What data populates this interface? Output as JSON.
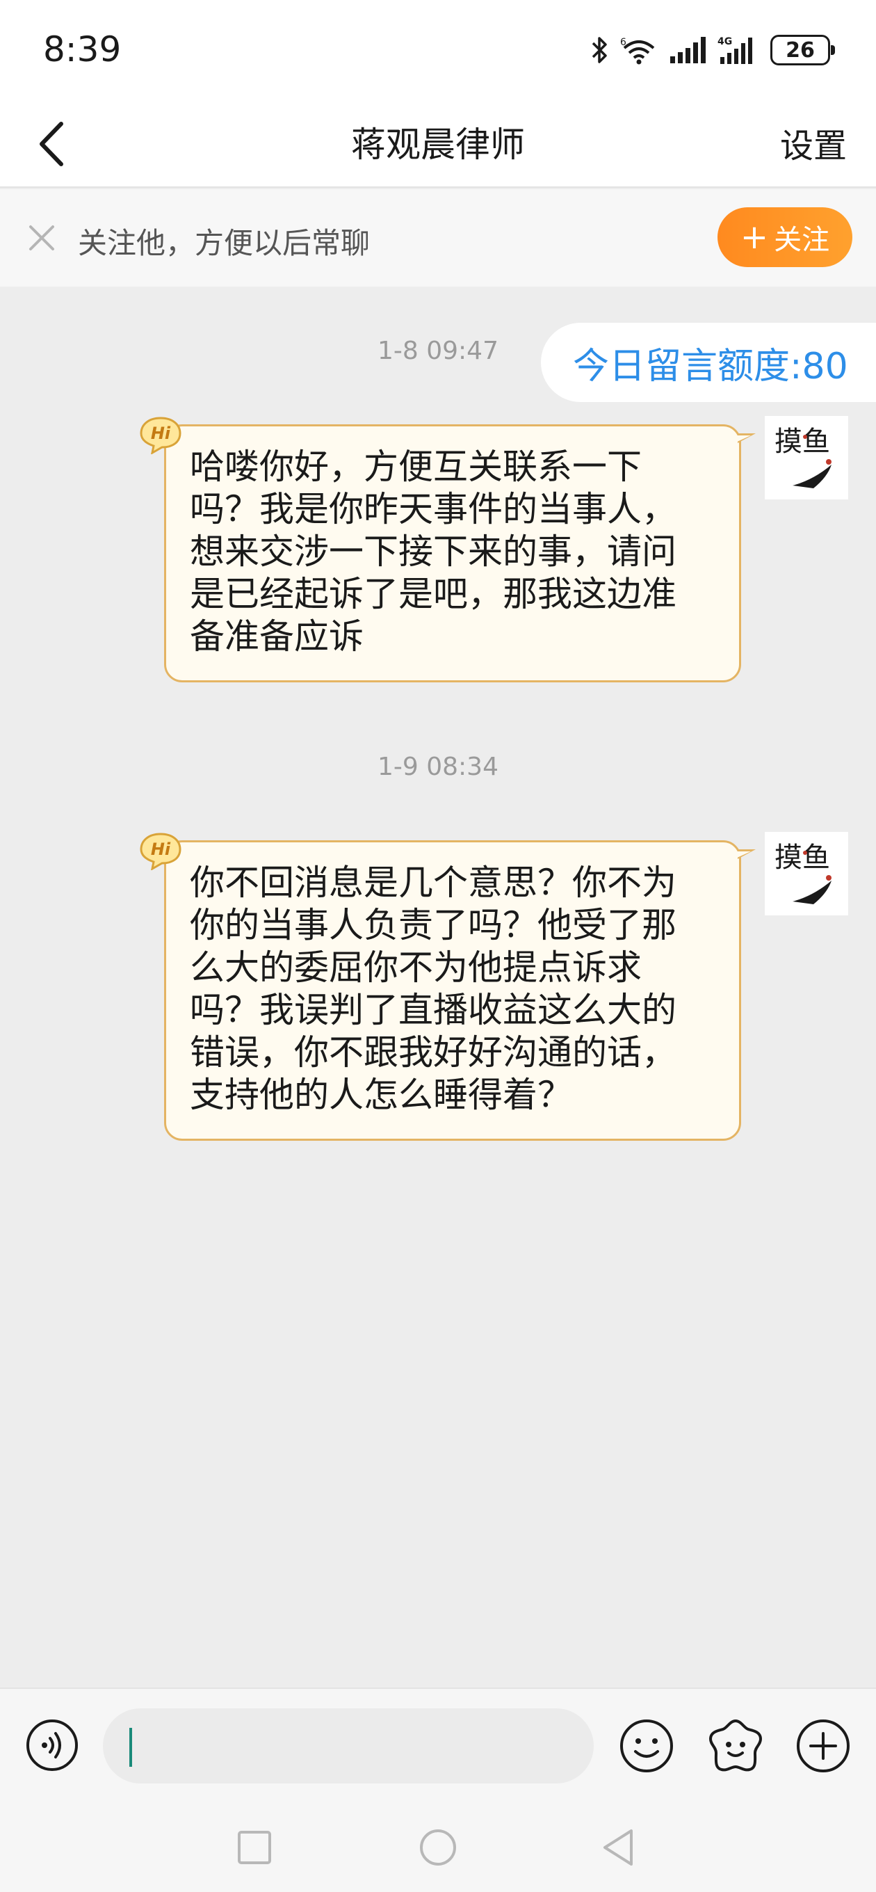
{
  "status_bar": {
    "time": "8:39",
    "battery": "26",
    "icons": [
      "bluetooth-icon",
      "wifi-icon",
      "signal-icon",
      "signal-4g-icon",
      "battery-icon"
    ]
  },
  "header": {
    "title": "蒋观晨律师",
    "settings_label": "设置",
    "back_icon": "chevron-left-icon"
  },
  "follow_bar": {
    "text": "关注他，方便以后常聊",
    "button_label": "关注",
    "button_plus": "+",
    "close_icon": "close-icon",
    "accent_color": "#ff8a1f"
  },
  "quota": {
    "text": "今日留言额度:80",
    "color": "#2d8ee8"
  },
  "messages": [
    {
      "timestamp": "1-8 09:47",
      "lines": [
        "哈喽你好，方便互关联系一下",
        "吗？我是你昨天事件的当事人，",
        "想来交涉一下接下来的事，请问",
        "是已经起诉了是吧，那我这边准",
        "备准备应诉"
      ],
      "badge": "Hi",
      "avatar_text": "摸鱼"
    },
    {
      "timestamp": "1-9 08:34",
      "lines": [
        "你不回消息是几个意思？你不为",
        "你的当事人负责了吗？他受了那",
        "么大的委屈你不为他提点诉求",
        "吗？我误判了直播收益这么大的",
        "错误，你不跟我好好沟通的话，",
        "支持他的人怎么睡得着？"
      ],
      "badge": "Hi",
      "avatar_text": "摸鱼"
    }
  ],
  "input_bar": {
    "placeholder": "",
    "icons": [
      "voice-icon",
      "emoji-icon",
      "sticker-icon",
      "plus-circle-icon"
    ]
  },
  "nav_bar": {
    "icons": [
      "recents-square-icon",
      "home-circle-icon",
      "back-triangle-icon"
    ]
  }
}
